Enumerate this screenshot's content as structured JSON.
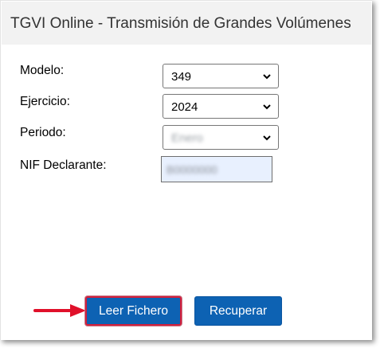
{
  "header": {
    "title": "TGVI Online - Transmisión de Grandes Volúmenes"
  },
  "form": {
    "modelo": {
      "label": "Modelo:",
      "value": "349"
    },
    "ejercicio": {
      "label": "Ejercicio:",
      "value": "2024"
    },
    "periodo": {
      "label": "Periodo:",
      "value": "Enero"
    },
    "nif": {
      "label": "NIF Declarante:",
      "value": "B0000000"
    }
  },
  "buttons": {
    "leer_fichero": "Leer Fichero",
    "recuperar": "Recuperar"
  },
  "colors": {
    "button_blue": "#0d62b3",
    "highlight_red": "#d21f3c",
    "header_bg": "#f2f2f2",
    "input_autofill_bg": "#e8f0fe"
  },
  "icons": {
    "select_chevron": "chevron-down-icon",
    "annotation_arrow": "arrow-right-icon"
  }
}
